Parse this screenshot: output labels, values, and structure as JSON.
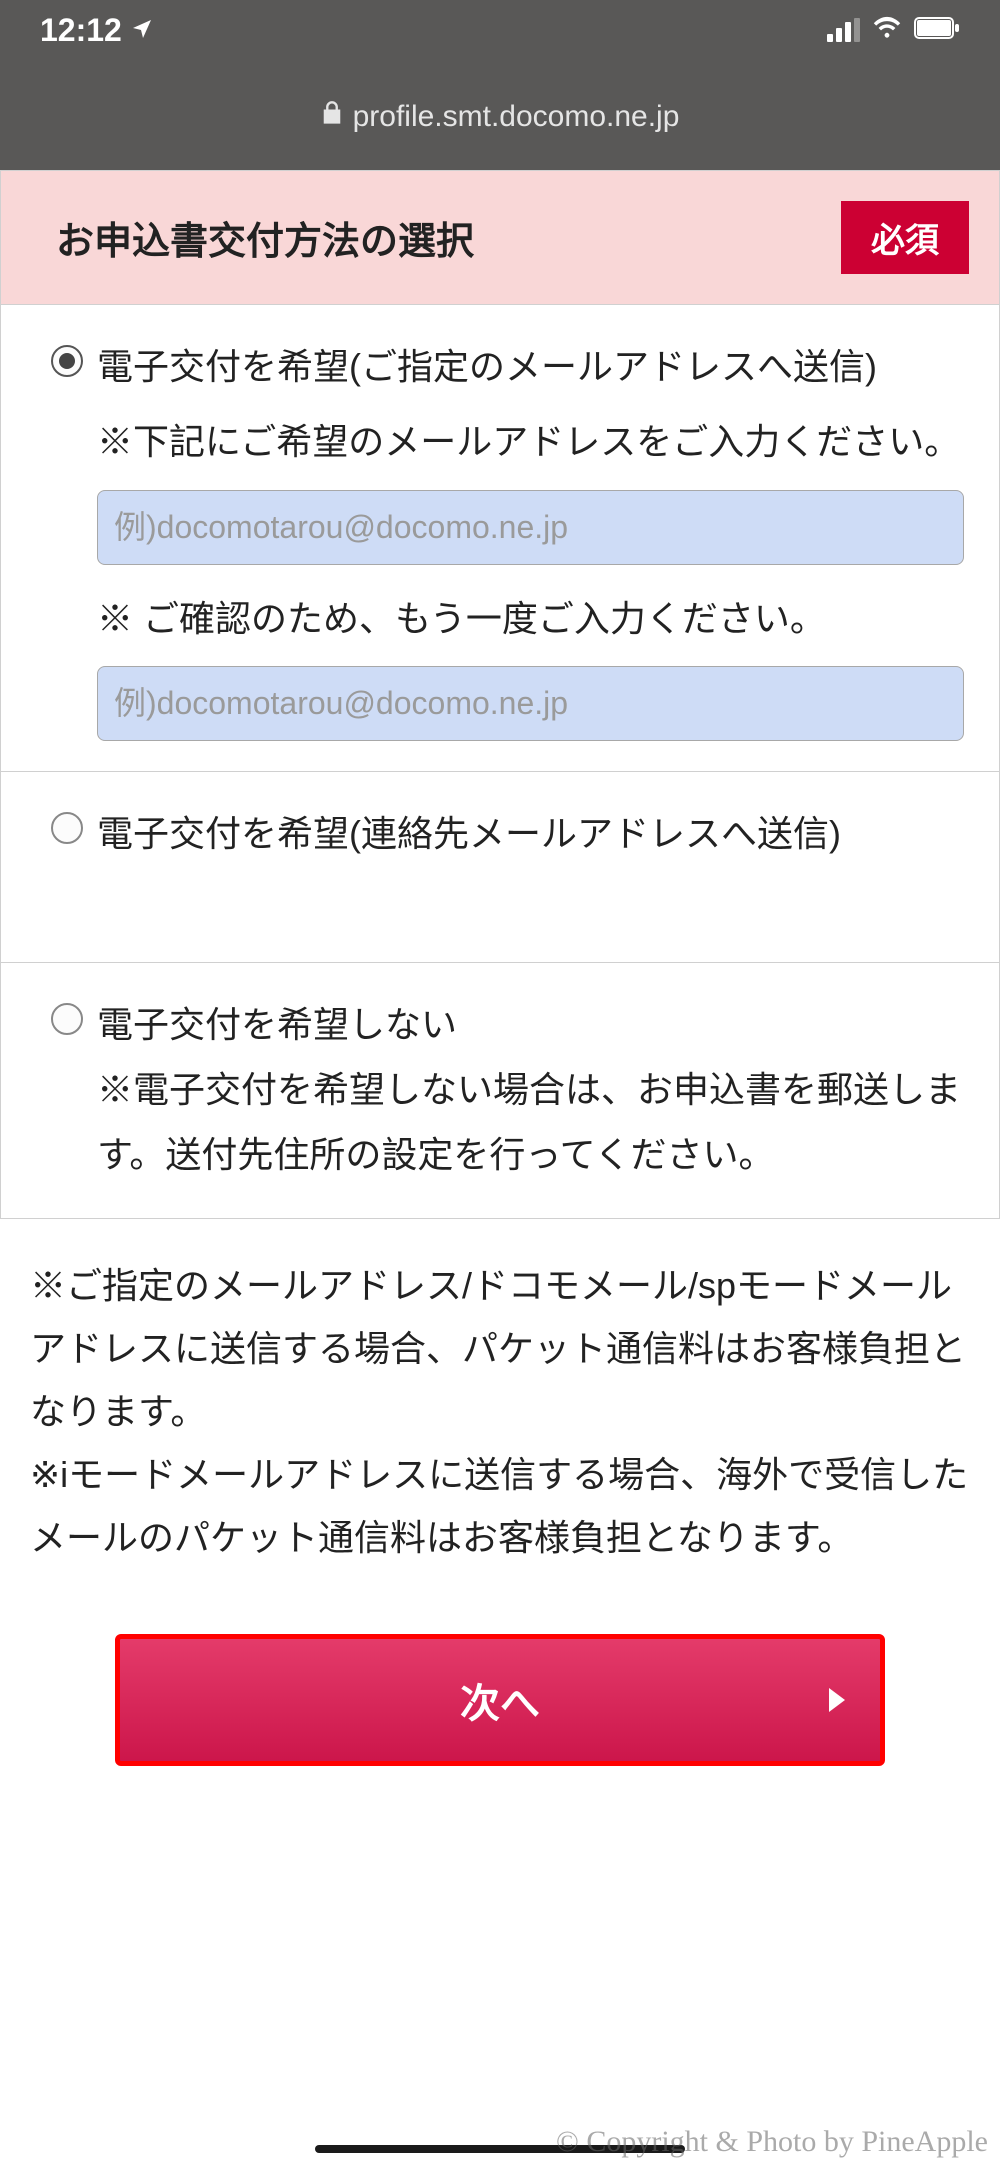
{
  "status_bar": {
    "time": "12:12",
    "location_icon": "location-arrow"
  },
  "url_bar": {
    "lock_icon": "lock",
    "url": "profile.smt.docomo.ne.jp"
  },
  "section": {
    "title": "お申込書交付方法の選択",
    "required_label": "必須"
  },
  "options": [
    {
      "label": "電子交付を希望(ご指定のメールアドレスへ送信)",
      "selected": true,
      "note1": "※下記にご希望のメールアドレスをご入力ください。",
      "placeholder1": "例)docomotarou@docomo.ne.jp",
      "value1": "",
      "note2": "※ ご確認のため、もう一度ご入力ください。",
      "placeholder2": "例)docomotarou@docomo.ne.jp",
      "value2": ""
    },
    {
      "label": "電子交付を希望(連絡先メールアドレスへ送信)",
      "selected": false
    },
    {
      "label": "電子交付を希望しない",
      "selected": false,
      "note": "※電子交付を希望しない場合は、お申込書を郵送します。送付先住所の設定を行ってください。"
    }
  ],
  "footer_notes": {
    "note1": "※ご指定のメールアドレス/ドコモメール/spモードメールアドレスに送信する場合、パケット通信料はお客様負担となります。",
    "note2": "※iモードメールアドレスに送信する場合、海外で受信したメールのパケット通信料はお客様負担となります。"
  },
  "next_button": {
    "label": "次へ"
  },
  "watermark": "© Copyright & Photo by PineApple"
}
